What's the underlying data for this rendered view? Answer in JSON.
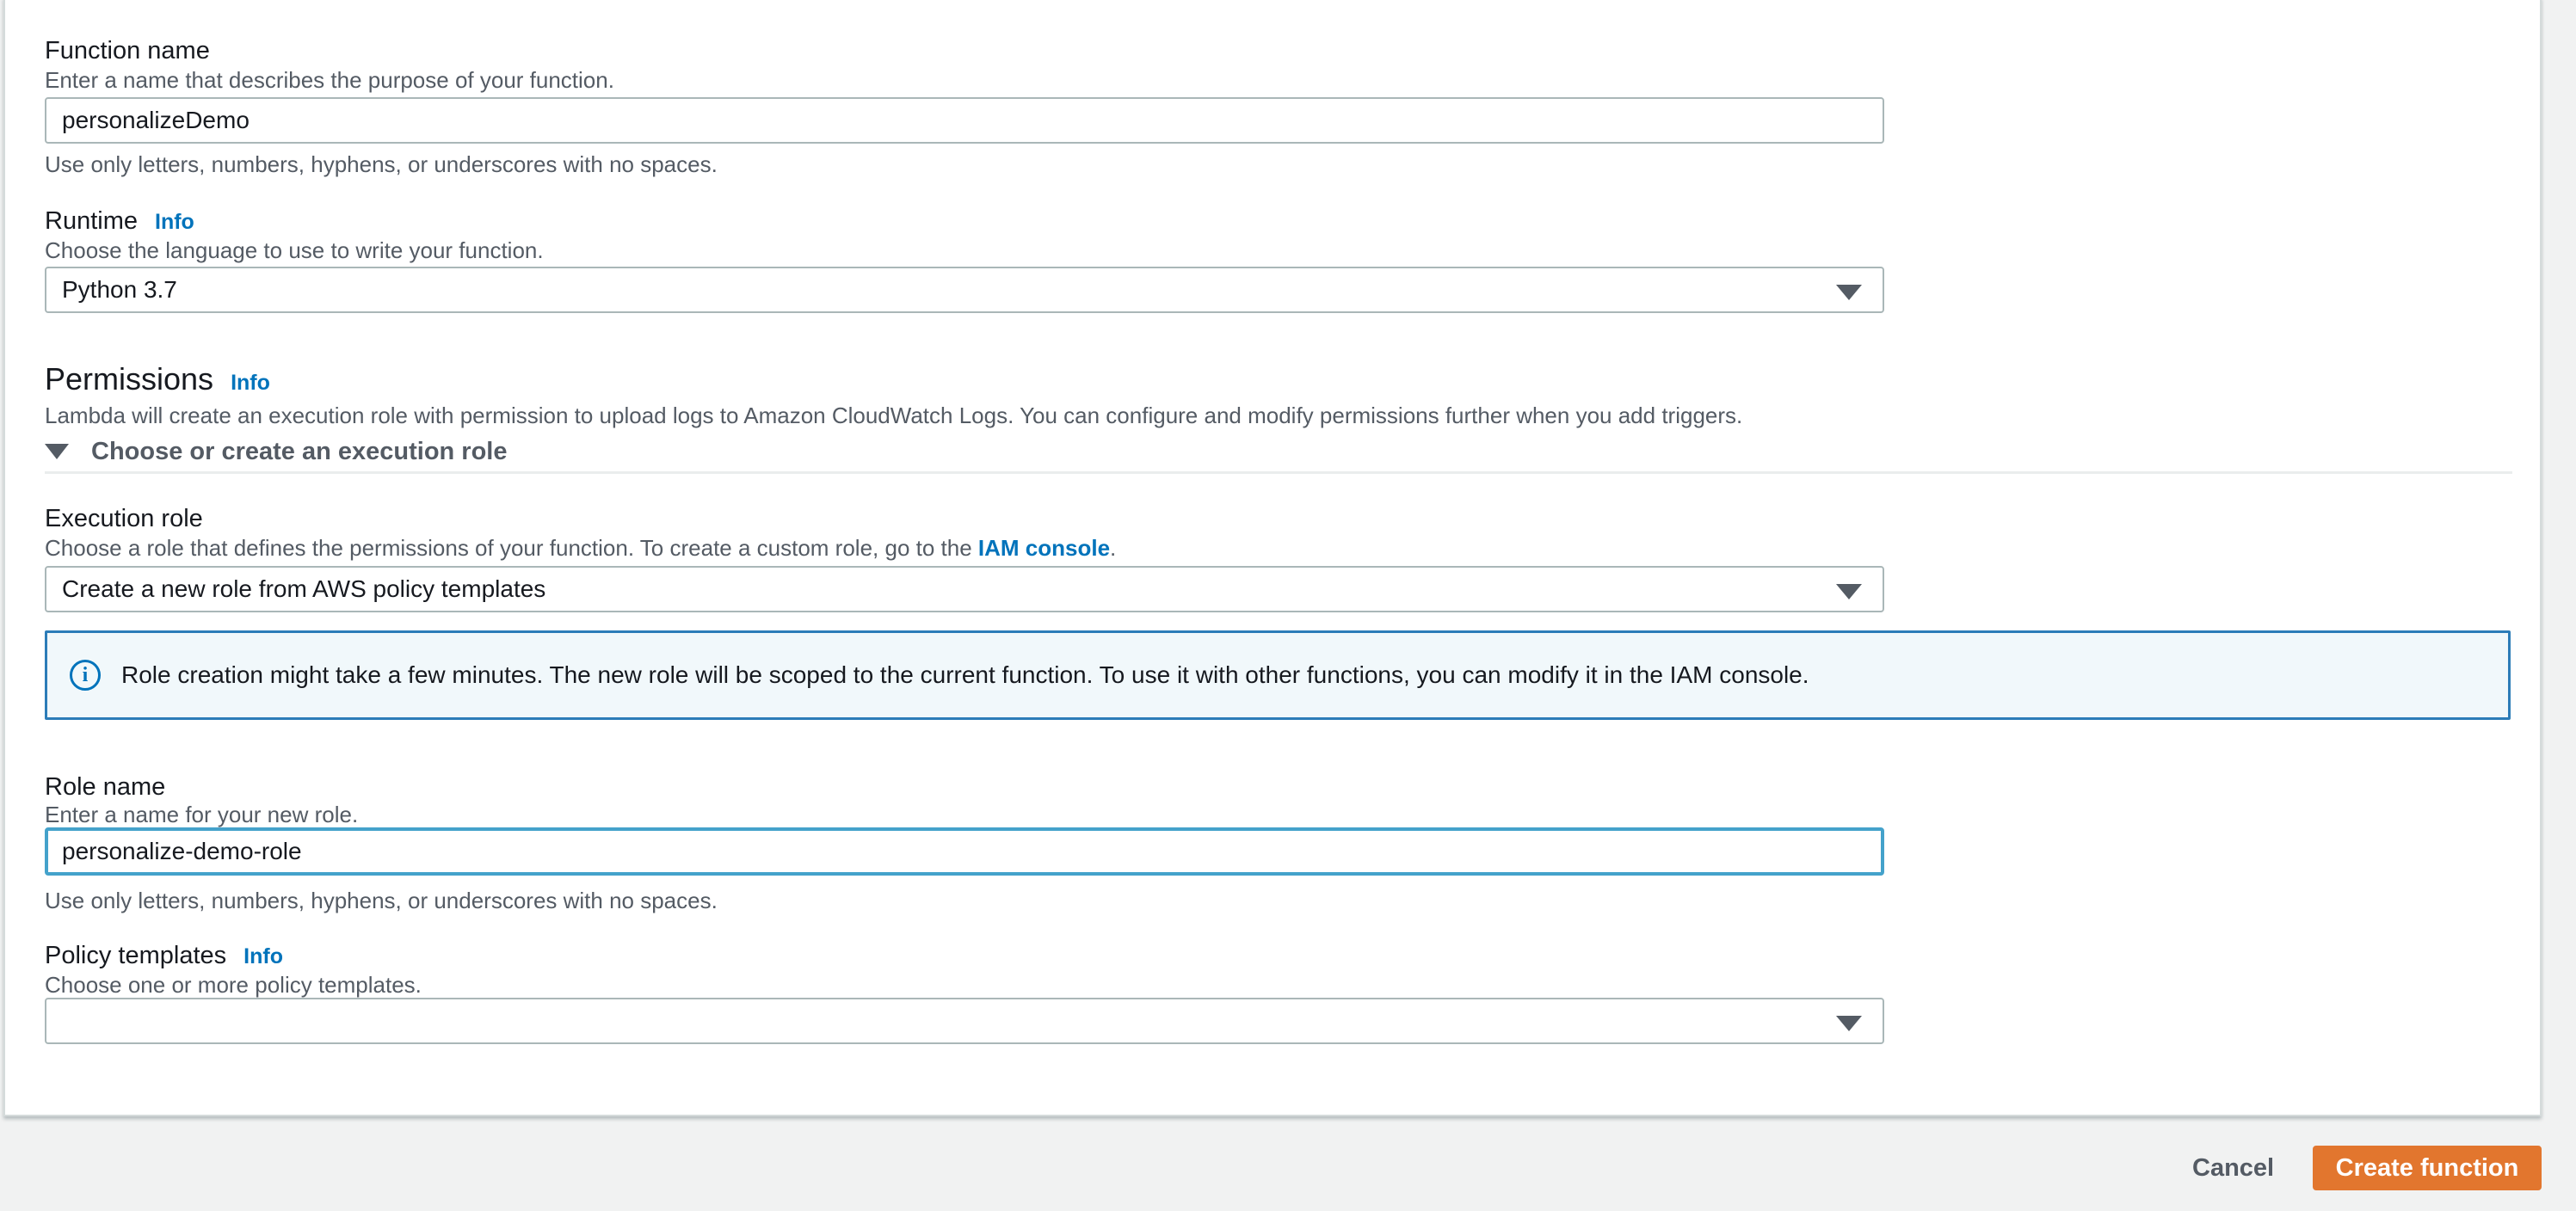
{
  "colors": {
    "page_background": "#f1f2f2",
    "card_background": "#ffffff",
    "accent_orange": "#e2762e",
    "link_blue": "#0073bb",
    "focus_border": "#44a2cb",
    "input_border": "#aab7b8",
    "label_text": "#16191f",
    "muted_text": "#545b64",
    "alert_border": "#2c7cb8",
    "alert_background": "#f1f8fb"
  },
  "form": {
    "function_name": {
      "label": "Function name",
      "description": "Enter a name that describes the purpose of your function.",
      "value": "personalizeDemo",
      "helper": "Use only letters, numbers, hyphens, or underscores with no spaces."
    },
    "runtime": {
      "label": "Runtime",
      "info_label": "Info",
      "description": "Choose the language to use to write your function.",
      "value": "Python 3.7"
    },
    "permissions": {
      "heading": "Permissions",
      "info_label": "Info",
      "description": "Lambda will create an execution role with permission to upload logs to Amazon CloudWatch Logs. You can configure and modify permissions further when you add triggers.",
      "expander_label": "Choose or create an execution role"
    },
    "execution_role": {
      "label": "Execution role",
      "description_prefix": "Choose a role that defines the permissions of your function. To create a custom role, go to the ",
      "link_text": "IAM console",
      "description_suffix": ".",
      "value": "Create a new role from AWS policy templates"
    },
    "alert": {
      "icon": "info-circle",
      "text": "Role creation might take a few minutes. The new role will be scoped to the current function. To use it with other functions, you can modify it in the IAM console."
    },
    "role_name": {
      "label": "Role name",
      "description": "Enter a name for your new role.",
      "value": "personalize-demo-role",
      "helper": "Use only letters, numbers, hyphens, or underscores with no spaces."
    },
    "policy_templates": {
      "label": "Policy templates",
      "info_label": "Info",
      "description": "Choose one or more policy templates.",
      "value": ""
    }
  },
  "footer": {
    "cancel_label": "Cancel",
    "create_label": "Create function"
  }
}
